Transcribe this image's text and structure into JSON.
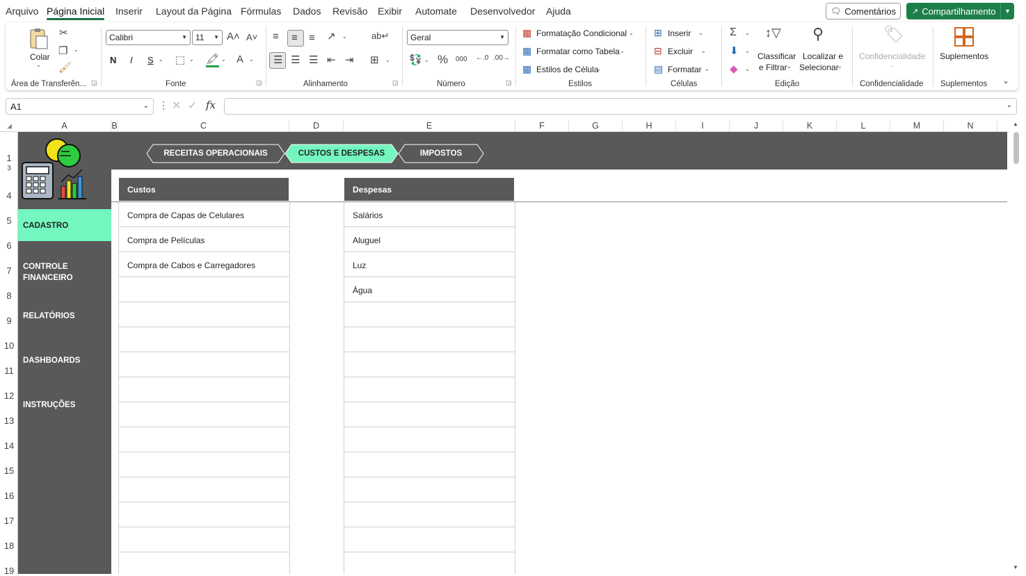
{
  "menu": {
    "items": [
      "Arquivo",
      "Página Inicial",
      "Inserir",
      "Layout da Página",
      "Fórmulas",
      "Dados",
      "Revisão",
      "Exibir",
      "Automate",
      "Desenvolvedor",
      "Ajuda"
    ],
    "comments_label": "Comentários",
    "share_label": "Compartilhamento",
    "accent": "#1e7e4a"
  },
  "ribbon": {
    "clipboard": {
      "paste_label": "Colar",
      "group_label": "Área de Transferên..."
    },
    "font": {
      "font_name": "Calibri",
      "font_size": "11",
      "bold": "N",
      "italic": "I",
      "underline": "S",
      "group_label": "Fonte"
    },
    "alignment": {
      "group_label": "Alinhamento"
    },
    "number": {
      "format": "Geral",
      "group_label": "Número"
    },
    "styles": {
      "conditional": "Formatação Condicional",
      "as_table": "Formatar como Tabela",
      "cell_styles": "Estilos de Célula",
      "group_label": "Estilos"
    },
    "cells": {
      "insert": "Inserir",
      "delete": "Excluir",
      "format": "Formatar",
      "group_label": "Células"
    },
    "editing": {
      "sort_line1": "Classificar",
      "sort_line2": "e Filtrar",
      "find_line1": "Localizar e",
      "find_line2": "Selecionar",
      "group_label": "Edição"
    },
    "sensitivity": {
      "label": "Confidencialidade",
      "group_label": "Confidencialidade"
    },
    "addins": {
      "label": "Suplementos",
      "group_label": "Suplementos"
    }
  },
  "formula_bar": {
    "name_box": "A1",
    "formula": ""
  },
  "columns": [
    "A",
    "B",
    "C",
    "D",
    "E",
    "F",
    "G",
    "H",
    "I",
    "J",
    "K",
    "L",
    "M",
    "N"
  ],
  "rows": [
    "1",
    "3",
    "4",
    "5",
    "6",
    "7",
    "8",
    "9",
    "10",
    "11",
    "12",
    "13",
    "14",
    "15",
    "16",
    "17",
    "18",
    "19"
  ],
  "sheet": {
    "tabs": [
      "RECEITAS OPERACIONAIS",
      "CUSTOS E DESPESAS",
      "IMPOSTOS"
    ],
    "active_tab": "CUSTOS E DESPESAS",
    "accent": "#73f7be",
    "nav": [
      "CADASTRO",
      "CONTROLE FINANCEIRO",
      "RELATÓRIOS",
      "DASHBOARDS",
      "INSTRUÇÕES"
    ],
    "nav_line2": {
      "controle": "FINANCEIRO"
    },
    "custos_header": "Custos",
    "despesas_header": "Despesas",
    "custos": [
      "Compra de Capas de Celulares",
      "Compra de Películas",
      "Compra de Cabos e Carregadores"
    ],
    "despesas": [
      "Salários",
      "Aluguel",
      "Luz",
      "Água"
    ]
  }
}
